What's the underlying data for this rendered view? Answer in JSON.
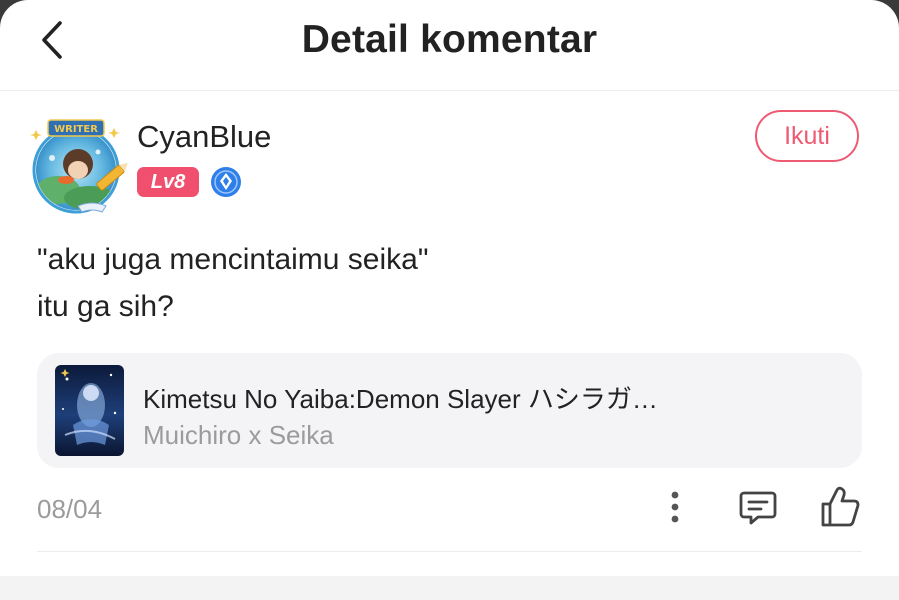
{
  "header": {
    "title": "Detail komentar",
    "back_icon": "chevron-left-icon"
  },
  "comment": {
    "username": "CyanBlue",
    "level": "Lv8",
    "avatar_frame_label": "WRITER",
    "follow_label": "Ikuti",
    "text_lines": [
      "\"aku juga mencintaimu seika\"",
      "itu ga sih?"
    ],
    "date": "08/04"
  },
  "book": {
    "title": "Kimetsu No Yaiba:Demon Slayer ハシラガ…",
    "subtitle": "Muichiro x Seika"
  },
  "actions": {
    "more_icon": "more-vertical-icon",
    "reply_icon": "comment-icon",
    "like_icon": "thumbs-up-icon"
  },
  "colors": {
    "accent": "#ef5a73",
    "level_badge": "#f0506e",
    "verify_badge": "#2f7fe8",
    "muted_text": "#9b9b9b",
    "card_bg": "#f4f4f6"
  }
}
